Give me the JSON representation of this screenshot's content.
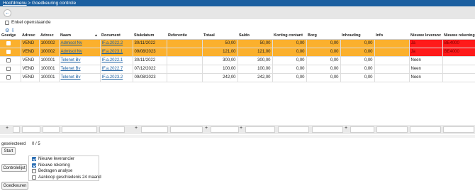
{
  "breadcrumb": {
    "home": "Hoofdmenu",
    "sep": ">",
    "current": "Goedkeuring controle"
  },
  "filter_toggle": {
    "label": "Enkel openstaande",
    "checked": false
  },
  "columns": [
    "Goedge",
    "Adresc",
    "Adresc",
    "Naam",
    "Document",
    "Stukdatum",
    "Referentie",
    "Totaal",
    "Saldo",
    "Korting contant",
    "Borg",
    "Inhouding",
    "Info",
    "Nieuwe leveranc",
    "Nieuwe rekening"
  ],
  "rows": [
    {
      "selected": true,
      "adres1": "VEND",
      "adres2": "100002",
      "naam": "Admisol Nv",
      "document": "IF.a.2022.2",
      "stukdatum": "30/11/2022",
      "referentie": "",
      "totaal": "50,00",
      "saldo": "50,00",
      "korting": "0,00",
      "borg": "0,00",
      "inhouding": "0,00",
      "info": "",
      "nieuwe_leverancier": "Ja",
      "nieuwe_rekening": "BE4000"
    },
    {
      "selected": true,
      "adres1": "VEND",
      "adres2": "100002",
      "naam": "Admisol Nv",
      "document": "IF.a.2023.1",
      "stukdatum": "09/08/2023",
      "referentie": "",
      "totaal": "121,00",
      "saldo": "121,00",
      "korting": "0,00",
      "borg": "0,00",
      "inhouding": "0,00",
      "info": "",
      "nieuwe_leverancier": "Ja",
      "nieuwe_rekening": "BE4000"
    },
    {
      "selected": false,
      "adres1": "VEND",
      "adres2": "100001",
      "naam": "Telenet Bv",
      "document": "IF.a.2022.1",
      "stukdatum": "30/11/2022",
      "referentie": "",
      "totaal": "300,00",
      "saldo": "300,00",
      "korting": "0,00",
      "borg": "0,00",
      "inhouding": "0,00",
      "info": "",
      "nieuwe_leverancier": "Neen",
      "nieuwe_rekening": ""
    },
    {
      "selected": false,
      "adres1": "VEND",
      "adres2": "100001",
      "naam": "Telenet Bv",
      "document": "IF.a.2022.7",
      "stukdatum": "07/12/2022",
      "referentie": "",
      "totaal": "100,00",
      "saldo": "100,00",
      "korting": "0,00",
      "borg": "0,00",
      "inhouding": "0,00",
      "info": "",
      "nieuwe_leverancier": "Neen",
      "nieuwe_rekening": ""
    },
    {
      "selected": false,
      "adres1": "VEND",
      "adres2": "100001",
      "naam": "Telenet Bv",
      "document": "IF.a.2023.2",
      "stukdatum": "09/08/2023",
      "referentie": "",
      "totaal": "242,00",
      "saldo": "242,00",
      "korting": "0,00",
      "borg": "0,00",
      "inhouding": "0,00",
      "info": "",
      "nieuwe_leverancier": "Neen",
      "nieuwe_rekening": ""
    }
  ],
  "footer": {
    "geselecteerd_label": "geselecteerd",
    "count": "0 / 5",
    "start_button": "Start",
    "controlelijst_button": "Controlelijst",
    "goedkeuren_button": "Goedkeuren",
    "options": [
      {
        "label": "Nieuwe leverancier",
        "checked": true
      },
      {
        "label": "Nieuwe rekening",
        "checked": true
      },
      {
        "label": "Bedragen analyse",
        "checked": false
      },
      {
        "label": "Aankoop geschiedenis 24 maand",
        "checked": false
      }
    ]
  },
  "colors": {
    "header": "#1b5fa0",
    "selected_row": "#fbb02d",
    "alert": "#ff1a1a"
  }
}
